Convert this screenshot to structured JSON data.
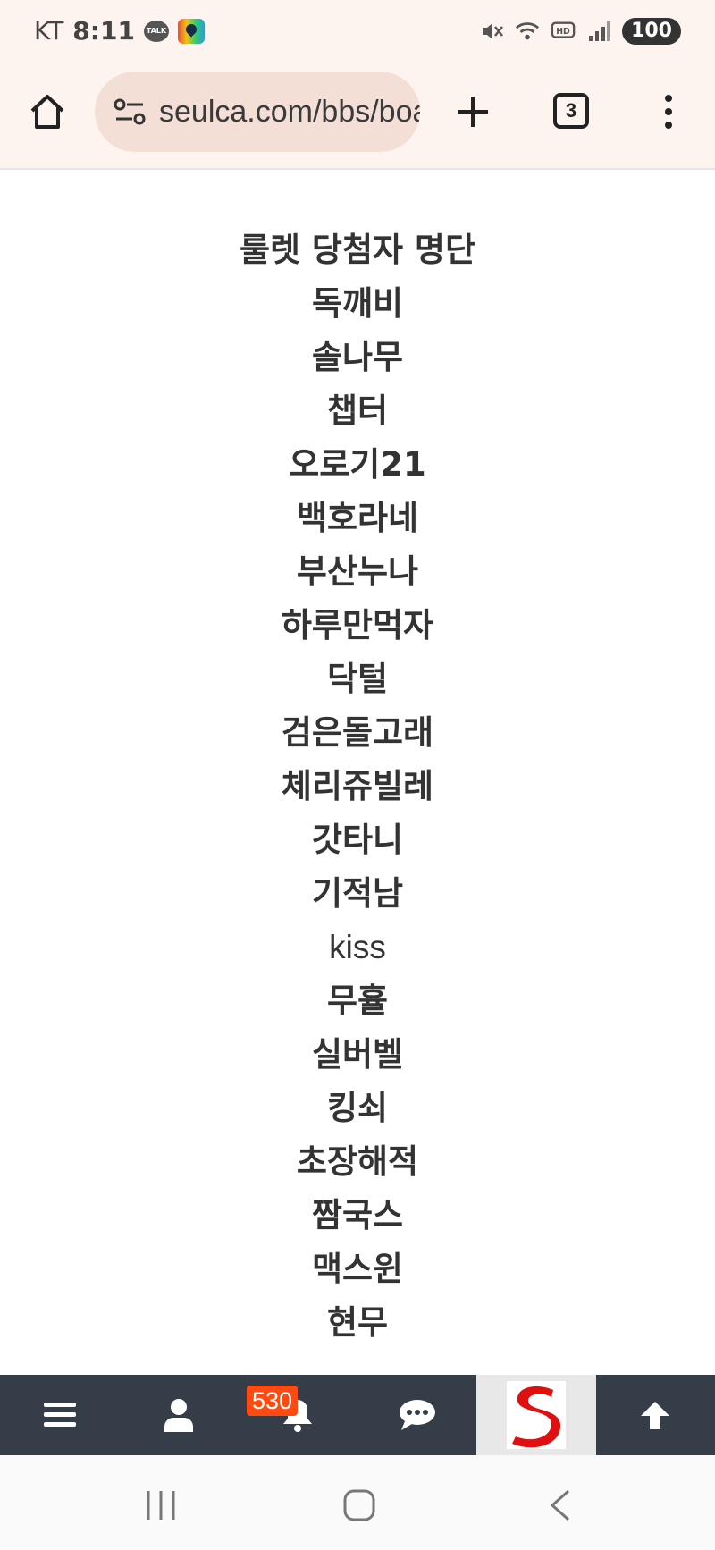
{
  "status_bar": {
    "carrier": "KT",
    "time": "8:11",
    "talk_icon_text": "TALK",
    "battery": "100",
    "icons": [
      "talk-icon",
      "map-icon",
      "mute-icon",
      "wifi-icon",
      "hd-icon",
      "signal-icon"
    ]
  },
  "browser": {
    "url": "seulca.com/bbs/board",
    "tab_count": "3",
    "icons": [
      "home-icon",
      "site-info-icon",
      "plus-icon",
      "more-icon"
    ]
  },
  "content": {
    "title": "룰렛 당첨자 명단",
    "winners": [
      "독깨비",
      "솔나무",
      "챕터",
      "오로기21",
      "백호라네",
      "부산누나",
      "하루만먹자",
      "닥털",
      "검은돌고래",
      "체리쥬빌레",
      "갓타니",
      "기적남",
      "kiss",
      "무휼",
      "실버벨",
      "킹쇠",
      "초장해적",
      "짬국스",
      "맥스윈",
      "현무"
    ]
  },
  "bottom_nav": {
    "notification_count": "530",
    "colors": {
      "background": "#343d48",
      "badge": "#ff4a12",
      "logo": "#e01010"
    },
    "icons": [
      "menu-icon",
      "user-icon",
      "bell-icon",
      "chat-icon",
      "site-logo",
      "arrow-up-icon"
    ]
  }
}
